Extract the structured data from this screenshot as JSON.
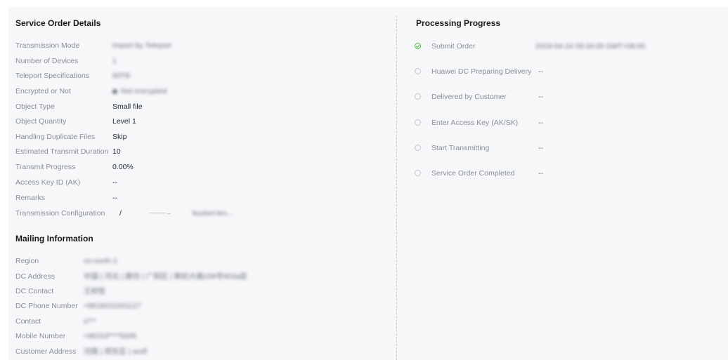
{
  "service_order": {
    "title": "Service Order Details",
    "rows": [
      {
        "label": "Transmission Mode",
        "value": "Import by Teleport"
      },
      {
        "label": "Number of Devices",
        "value": "1"
      },
      {
        "label": "Teleport Specifications",
        "value": "60TB"
      },
      {
        "label": "Encrypted or Not",
        "value": "Not encrypted"
      },
      {
        "label": "Object Type",
        "value": "Small file"
      },
      {
        "label": "Object Quantity",
        "value": "Level 1"
      },
      {
        "label": "Handling Duplicate Files",
        "value": "Skip"
      },
      {
        "label": "Estimated Transmit Duration",
        "value": "10"
      },
      {
        "label": "Transmit Progress",
        "value": "0.00%"
      },
      {
        "label": "Access Key ID (AK)",
        "value": "--"
      },
      {
        "label": "Remarks",
        "value": "--"
      },
      {
        "label": "Transmission Configuration",
        "value": "/",
        "arrow": "---------→",
        "target": "bucket-leo..."
      }
    ]
  },
  "mailing": {
    "title": "Mailing Information",
    "rows": [
      {
        "label": "Region",
        "value": "cn-north-1"
      },
      {
        "label": "DC Address",
        "value": "中国 | 河北 | 廊坊 | 广阳区 | 枫杞大路208号903a层"
      },
      {
        "label": "DC Contact",
        "value": "王树哲"
      },
      {
        "label": "DC Phone Number",
        "value": "+8618221041127"
      },
      {
        "label": "Contact",
        "value": "s***"
      },
      {
        "label": "Mobile Number",
        "value": "+86153****5506"
      },
      {
        "label": "Customer Address",
        "value": "河南 | 郑东区 | andf"
      }
    ]
  },
  "progress": {
    "title": "Processing Progress",
    "steps": [
      {
        "label": "Submit Order",
        "value": "2019-04-24 09:34:00 GMT+08:00",
        "done": true
      },
      {
        "label": "Huawei DC Preparing Delivery",
        "value": "--",
        "done": false
      },
      {
        "label": "Delivered by Customer",
        "value": "--",
        "done": false
      },
      {
        "label": "Enter Access Key (AK/SK)",
        "value": "--",
        "done": false
      },
      {
        "label": "Start Transmitting",
        "value": "--",
        "done": false
      },
      {
        "label": "Service Order Completed",
        "value": "--",
        "done": false
      }
    ]
  }
}
